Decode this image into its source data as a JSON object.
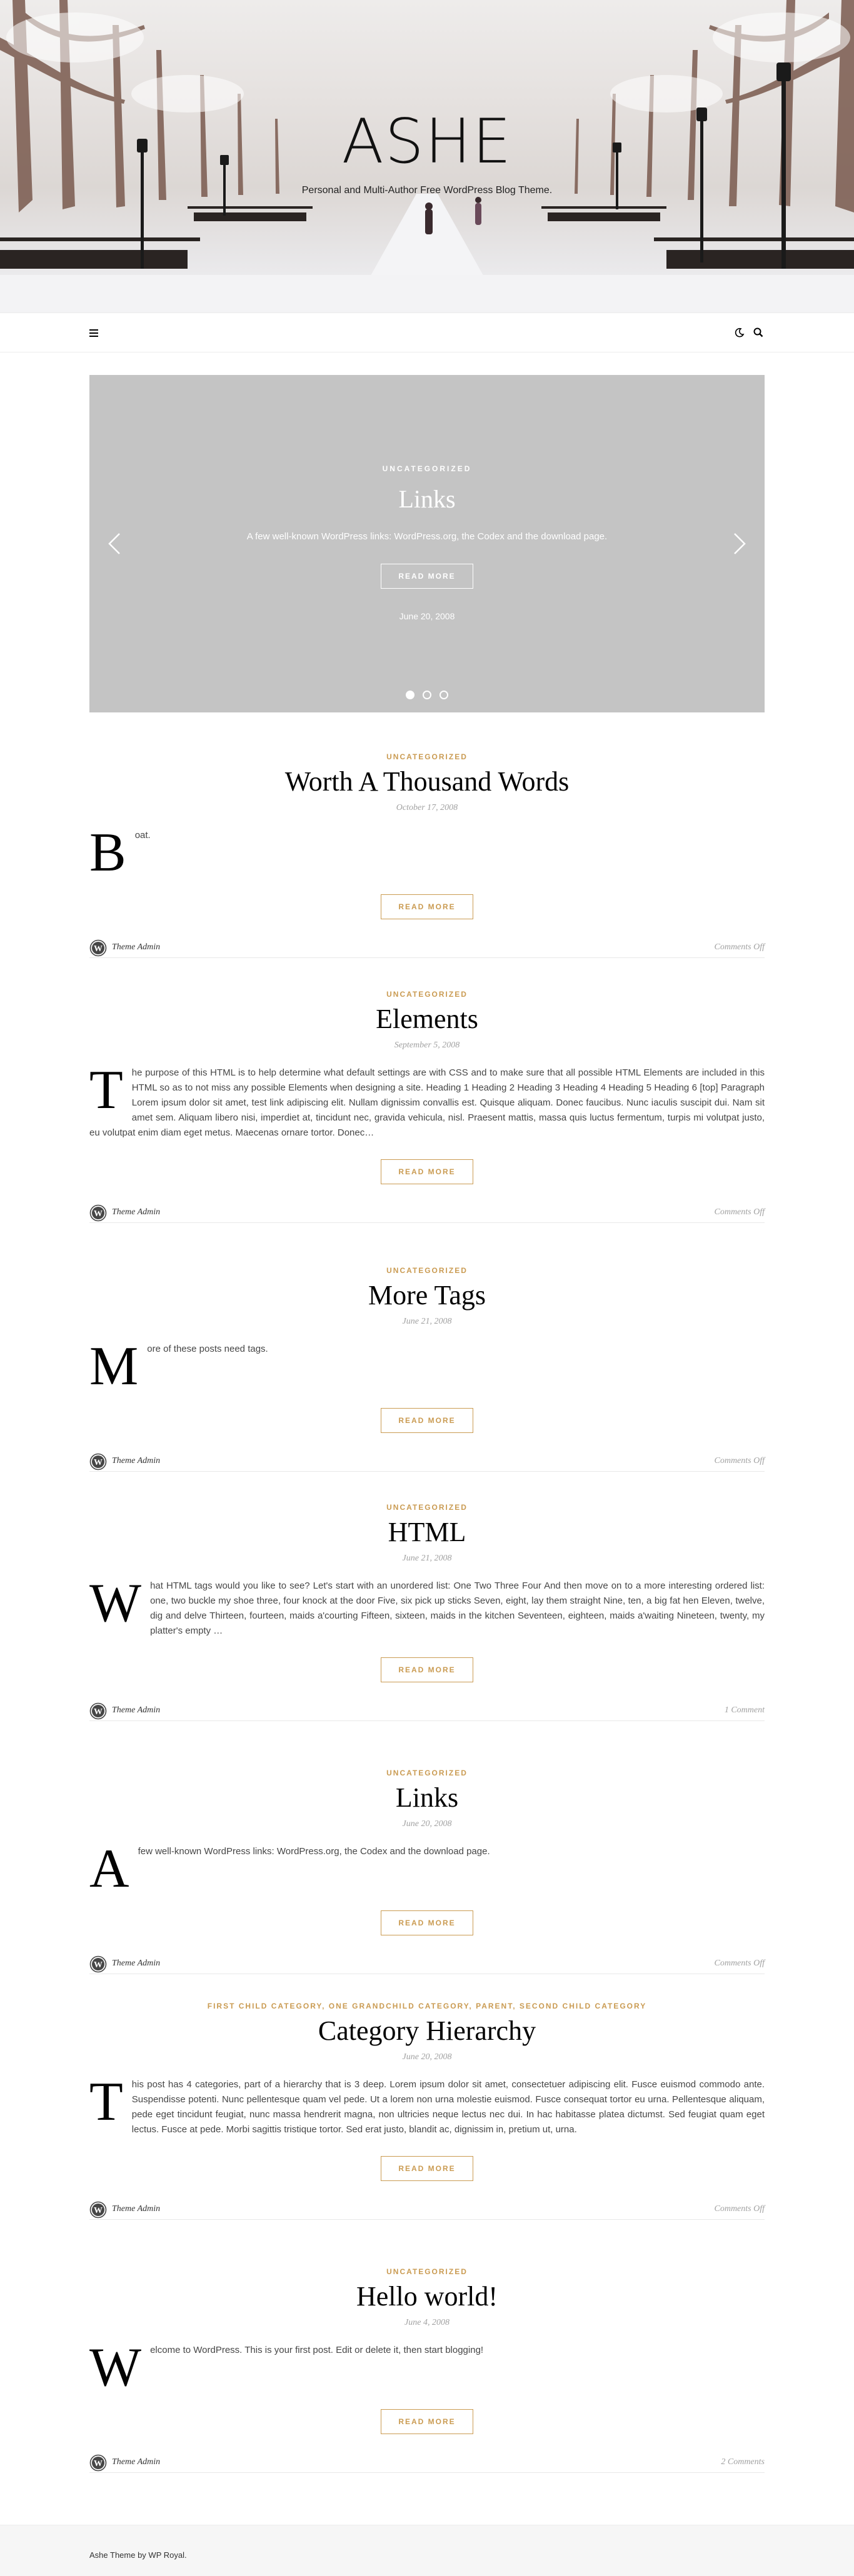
{
  "header": {
    "site_title": "ASHE",
    "tagline": "Personal and Multi-Author Free WordPress Blog Theme."
  },
  "nav": {
    "menu_icon": "hamburger-icon",
    "dark_mode_icon": "moon-icon",
    "search_icon": "search-icon"
  },
  "slider": {
    "category": "UNCATEGORIZED",
    "title": "Links",
    "excerpt": "A few well-known WordPress links: WordPress.org, the Codex and the download page.",
    "button": "READ MORE",
    "date": "June 20, 2008",
    "slide_count": 3,
    "active_slide": 1
  },
  "posts": [
    {
      "category": "UNCATEGORIZED",
      "title": "Worth A Thousand Words",
      "date": "October 17, 2008",
      "dropcap": "B",
      "excerpt": "oat.",
      "button": "READ MORE",
      "author": "Theme Admin",
      "comments": "Comments Off"
    },
    {
      "category": "UNCATEGORIZED",
      "title": "Elements",
      "date": "September 5, 2008",
      "dropcap": "T",
      "excerpt": "he purpose of this HTML is to help determine what default settings are with CSS and to make sure that all possible HTML Elements are included in this HTML so as to not miss any possible Elements when designing a site. Heading 1 Heading 2 Heading 3 Heading 4 Heading 5 Heading 6 [top] Paragraph Lorem ipsum dolor sit amet, test link adipiscing elit. Nullam dignissim convallis est. Quisque aliquam. Donec faucibus. Nunc iaculis suscipit dui. Nam sit amet sem. Aliquam libero nisi, imperdiet at, tincidunt nec, gravida vehicula, nisl. Praesent mattis, massa quis luctus fermentum, turpis mi volutpat justo, eu volutpat enim diam eget metus. Maecenas ornare tortor. Donec…",
      "button": "READ MORE",
      "author": "Theme Admin",
      "comments": "Comments Off"
    },
    {
      "category": "UNCATEGORIZED",
      "title": "More Tags",
      "date": "June 21, 2008",
      "dropcap": "M",
      "excerpt": "ore of these posts need tags.",
      "button": "READ MORE",
      "author": "Theme Admin",
      "comments": "Comments Off"
    },
    {
      "category": "UNCATEGORIZED",
      "title": "HTML",
      "date": "June 21, 2008",
      "dropcap": "W",
      "excerpt": "hat HTML tags would you like to see? Let's start with an unordered list: One Two Three Four And then move on to a more interesting ordered list: one, two buckle my shoe three, four knock at the door Five, six pick up sticks Seven, eight, lay them straight Nine, ten, a big fat hen Eleven, twelve, dig and delve Thirteen, fourteen, maids a'courting Fifteen, sixteen, maids in the kitchen Seventeen, eighteen, maids a'waiting Nineteen, twenty, my platter's empty …",
      "button": "READ MORE",
      "author": "Theme Admin",
      "comments": "1 Comment"
    },
    {
      "category": "UNCATEGORIZED",
      "title": "Links",
      "date": "June 20, 2008",
      "dropcap": "A",
      "excerpt": " few well-known WordPress links: WordPress.org, the Codex and the download page.",
      "button": "READ MORE",
      "author": "Theme Admin",
      "comments": "Comments Off"
    },
    {
      "category": "FIRST CHILD CATEGORY, ONE GRANDCHILD CATEGORY, PARENT, SECOND CHILD CATEGORY",
      "title": "Category Hierarchy",
      "date": "June 20, 2008",
      "dropcap": "T",
      "excerpt": "his post has 4 categories, part of a hierarchy that is 3 deep. Lorem ipsum dolor sit amet, consectetuer adipiscing elit. Fusce euismod commodo ante. Suspendisse potenti. Nunc pellentesque quam vel pede. Ut a lorem non urna molestie euismod. Fusce consequat tortor eu urna. Pellentesque aliquam, pede eget tincidunt feugiat, nunc massa hendrerit magna, non ultricies neque lectus nec dui. In hac habitasse platea dictumst. Sed feugiat quam eget lectus. Fusce at pede. Morbi sagittis tristique tortor. Sed erat justo, blandit ac, dignissim in, pretium ut, urna.",
      "button": "READ MORE",
      "author": "Theme Admin",
      "comments": "Comments Off"
    },
    {
      "category": "UNCATEGORIZED",
      "title": "Hello world!",
      "date": "June 4, 2008",
      "dropcap": "W",
      "excerpt": "elcome to WordPress. This is your first post. Edit or delete it, then start blogging!",
      "button": "READ MORE",
      "author": "Theme Admin",
      "comments": "2 Comments"
    }
  ],
  "footer": {
    "copyright": "Ashe Theme by WP Royal."
  },
  "colors": {
    "accent": "#ca9b52",
    "slider_bg": "#c4c4c4",
    "text": "#464646",
    "muted": "#a1a1a1"
  }
}
